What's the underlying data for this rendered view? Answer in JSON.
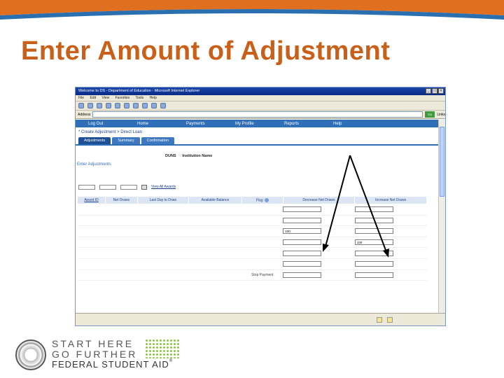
{
  "slide": {
    "title": "Enter Amount of Adjustment",
    "colors": {
      "title": "#c8601a",
      "wave_orange": "#e07020",
      "wave_blue": "#2a6fb0"
    }
  },
  "browser": {
    "window_title": "Welcome to DS - Department of Education - Microsoft Internet Explorer",
    "menu": [
      "File",
      "Edit",
      "View",
      "Favorites",
      "Tools",
      "Help"
    ],
    "address_label": "Address",
    "address_value": "",
    "go_label": "Go",
    "links_label": "Links"
  },
  "nav": [
    "Log Out",
    "Home",
    "Payments",
    "My Profile",
    "Reports",
    "Help"
  ],
  "breadcrumb": {
    "create": "Create Adjustment",
    "program": "Direct Loan"
  },
  "tabs": [
    "Adjustments",
    "Summary",
    "Confirmation"
  ],
  "institution": {
    "duns_label": "DUNS",
    "name_label": "Institution Name"
  },
  "section": {
    "title": "Enter Adjustments",
    "note": ""
  },
  "pager": {
    "go_label": "",
    "view_all": "View All Awards"
  },
  "table": {
    "headers": [
      "Award ID",
      "Net Draws",
      "Last Day to Draw",
      "Available Balance",
      "Flag",
      "Decrease Net Draws",
      "Increase Net Draws"
    ],
    "rows": [
      {
        "decrease": "",
        "increase": ""
      },
      {
        "decrease": "",
        "increase": ""
      },
      {
        "decrease": "100",
        "increase": ""
      },
      {
        "decrease": "",
        "increase": "100"
      },
      {
        "decrease": "",
        "increase": ""
      },
      {
        "decrease": "",
        "increase": ""
      },
      {
        "decrease": "",
        "increase": ""
      }
    ],
    "flag_row_text": "Stop Payment"
  },
  "footer": {
    "line1": "START HERE",
    "line2": "GO FURTHER",
    "line3": "FEDERAL STUDENT AID"
  }
}
